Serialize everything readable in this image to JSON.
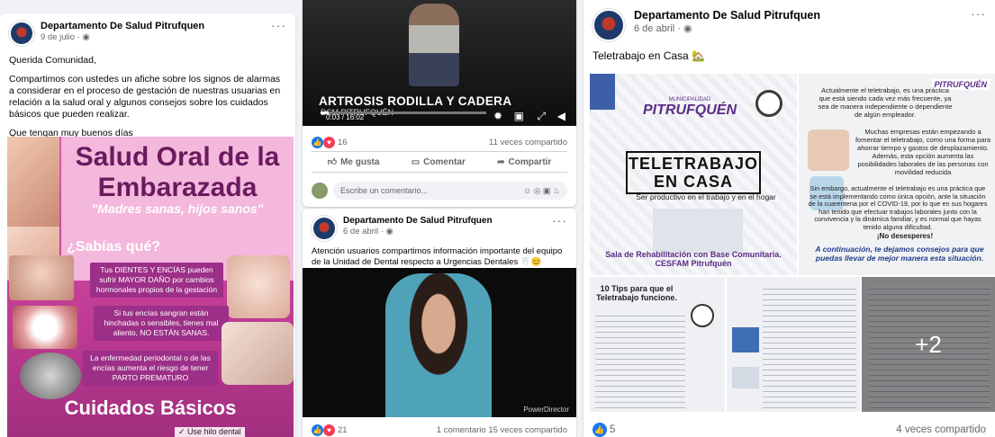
{
  "post1": {
    "page_name": "Departamento De Salud Pitrufquen",
    "date": "9 de julio · ",
    "more": "···",
    "line1": "Querida Comunidad,",
    "line2": "Compartimos con ustedes un afiche sobre los signos de alarmas a considerar en el proceso de gestación de nuestras usuarias en relación a la salud oral y algunos consejos sobre los cuidados básicos que pueden realizar.",
    "line3": "Que tengan muy buenos días",
    "poster": {
      "title": "Salud Oral de la Embarazada",
      "subtitle": "\"Madres sanas, hijos sanos\"",
      "sabias": "¿Sabías qué?",
      "box1": "Tus DIENTES Y ENCÍAS pueden sufrir MAYOR DAÑO por cambios hormonales propios de la gestación",
      "box2": "Si tus encías sangran están hinchadas o sensibles, tienes mal aliento, NO ESTÁN SANAS.",
      "box3": "La enfermedad periodontal o de las encías aumenta el riesgo de tener PARTO PREMATURO",
      "footer": "Cuidados Básicos",
      "hilo": "✓ Use hilo dental"
    }
  },
  "post2": {
    "video_title": "ARTROSIS RODILLA Y CADERA",
    "video_sub": "DSM PITRUFQUÉN",
    "time": "0:03 / 16:02",
    "reactions": "16",
    "shares": "11 veces compartido",
    "like": "Me gusta",
    "comment": "Comentar",
    "share": "Compartir",
    "comment_placeholder": "Escribe un comentario...",
    "comment_icons": "☺ ◎ ▣ ♨"
  },
  "post3": {
    "page_name": "Departamento De Salud Pitrufquen",
    "date": "6 de abril · ",
    "more": "···",
    "text": "Atención usuarios compartimos información importante del equipo de la Unidad de Dental respecto a Urgencias Dentales 🦷😊",
    "watermark": "PowerDirector",
    "reactions": "21",
    "shares": "1 comentario  15 veces compartido"
  },
  "post4": {
    "page_name": "Departamento De Salud Pitrufquen",
    "date": "6 de abril · ",
    "more": "···",
    "text": "Teletrabajo en Casa 🏡",
    "tile1": {
      "muni": "MUNICIPALIDAD",
      "logo": "PITRUFQUÉN",
      "title": "TELETRABAJO EN CASA",
      "tagline": "Ser productivo en el trabajo  y en el hogar",
      "footer": "Sala de Rehabilitación con Base Comunitaria. CESFAM Pitrufquén"
    },
    "tile2": {
      "logo": "PITRUFQUÉN",
      "p1": "Actualmente el teletrabajo, es una práctica que está siendo cada vez más frecuente, ya sea de manera independiente o dependiente de algún empleador.",
      "p2": "Muchas empresas están empezando a fomentar el teletrabajo, como una forma para ahorrar tiempo y gastos de desplazamiento. Además, esta opción aumenta las posibilidades laborales de las personas con movilidad reducida",
      "p3": "Sin embargo, actualmente el teletrabajo es una práctica que se está implementando como única opción, ante la situación de la cuarentena por el COVID-19, por lo que en sus hogares han tenido que efectuar trabajos laborales junto con la convivencia y la dinámica familiar, y es normal que hayas tenido alguna dificultad.",
      "p4": "¡No desesperes!",
      "p5": "A continuación, te dejamos consejos para que puedas llevar de mejor manera esta situación."
    },
    "tile3": {
      "title": "10 Tips para que el Teletrabajo funcione."
    },
    "tile5": {
      "more": "+2"
    },
    "reactions": "5",
    "shares": "4 veces compartido"
  }
}
